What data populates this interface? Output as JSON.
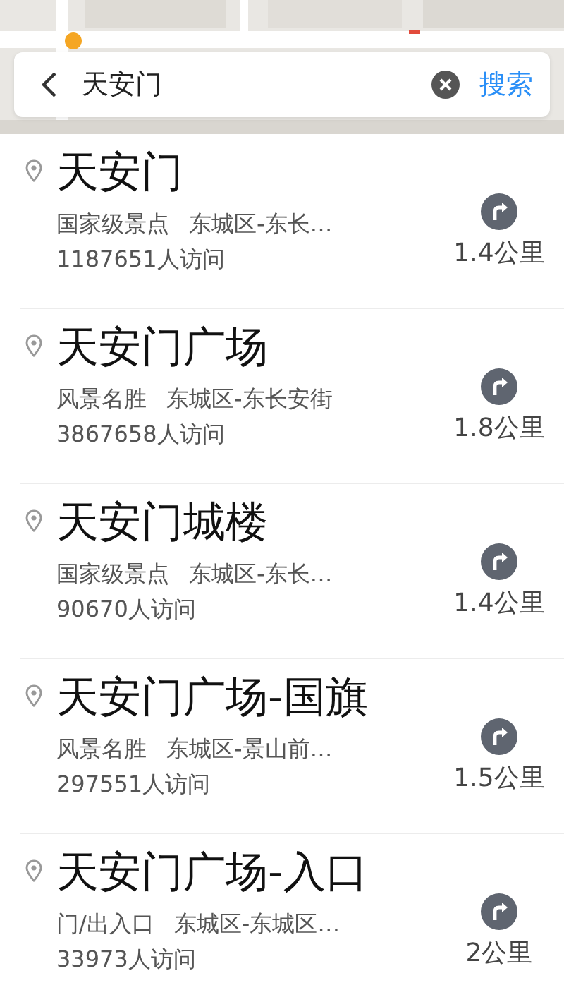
{
  "search": {
    "value": "天安门",
    "action": "搜索"
  },
  "results": [
    {
      "name": "天安门",
      "category": "国家级景点",
      "address": "东城区-东长…",
      "visits": "1187651人访问",
      "distance": "1.4公里"
    },
    {
      "name": "天安门广场",
      "category": "风景名胜",
      "address": "东城区-东长安街",
      "visits": "3867658人访问",
      "distance": "1.8公里"
    },
    {
      "name": "天安门城楼",
      "category": "国家级景点",
      "address": "东城区-东长…",
      "visits": "90670人访问",
      "distance": "1.4公里"
    },
    {
      "name": "天安门广场-国旗",
      "category": "风景名胜",
      "address": "东城区-景山前…",
      "visits": "297551人访问",
      "distance": "1.5公里"
    },
    {
      "name": "天安门广场-入口",
      "category": "门/出入口",
      "address": "东城区-东城区…",
      "visits": "33973人访问",
      "distance": "2公里"
    }
  ]
}
